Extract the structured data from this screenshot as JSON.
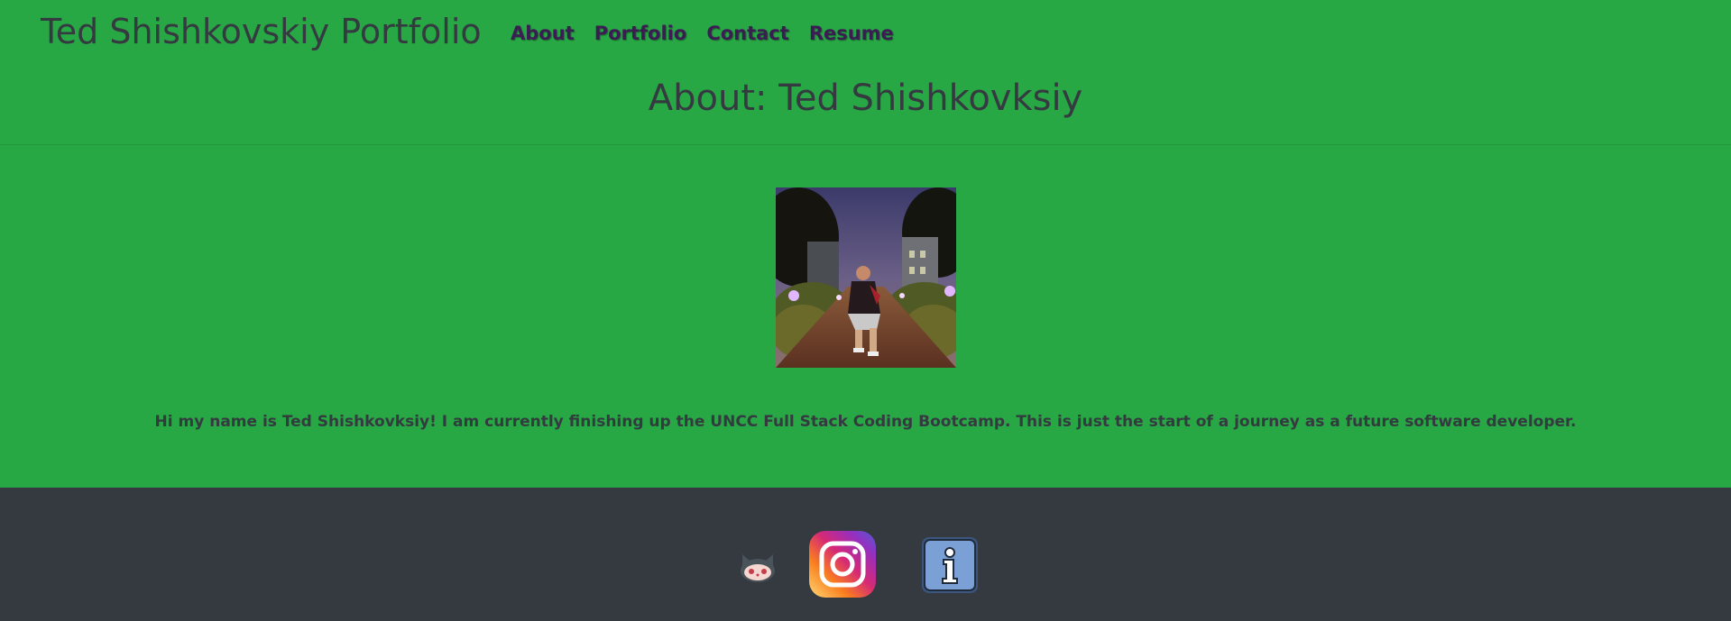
{
  "header": {
    "site_title": "Ted Shishkovskiy Portfolio",
    "nav": [
      {
        "label": "About"
      },
      {
        "label": "Portfolio"
      },
      {
        "label": "Contact"
      },
      {
        "label": "Resume"
      }
    ]
  },
  "main": {
    "heading": "About: Ted Shishkovksiy",
    "profile_photo": {
      "alt": "Profile photo of Ted Shishkovskiy"
    },
    "intro": "Hi my name is Ted Shishkovksiy! I am currently finishing up the UNCC Full Stack Coding Bootcamp. This is just the start of a journey as a future software developer."
  },
  "footer": {
    "links": [
      {
        "icon": "github-icon"
      },
      {
        "icon": "instagram-icon"
      },
      {
        "icon": "info-icon"
      }
    ]
  },
  "colors": {
    "page_background": "#28a745",
    "footer_background": "#343a40",
    "nav_link": "#3b1d54",
    "text": "#343a40"
  }
}
